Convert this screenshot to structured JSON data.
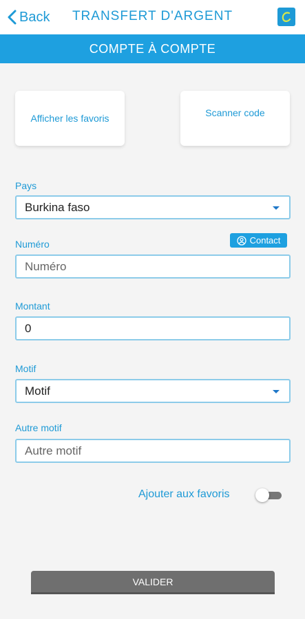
{
  "header": {
    "back_label": "Back",
    "title": "TRANSFERT D'ARGENT",
    "accent_color": "#1e9ad6"
  },
  "subheader": {
    "title": "COMPTE À COMPTE",
    "color": "#1ea0e0"
  },
  "cards": {
    "favorites_label": "Afficher les favoris",
    "scan_label": "Scanner code"
  },
  "form": {
    "pays": {
      "label": "Pays",
      "value": "Burkina faso"
    },
    "numero": {
      "label": "Numéro",
      "placeholder": "Numéro",
      "contact_label": "Contact"
    },
    "montant": {
      "label": "Montant",
      "value": "0"
    },
    "motif": {
      "label": "Motif",
      "value": "Motif"
    },
    "autre_motif": {
      "label": "Autre motif",
      "placeholder": "Autre motif"
    }
  },
  "favorites_toggle": {
    "label": "Ajouter aux favoris",
    "on": false
  },
  "submit": {
    "label": "VALIDER"
  },
  "icons": {
    "back": "chevron-left-icon",
    "logo": "app-logo-icon",
    "contact": "person-circle-icon",
    "dropdown": "caret-down-icon"
  }
}
